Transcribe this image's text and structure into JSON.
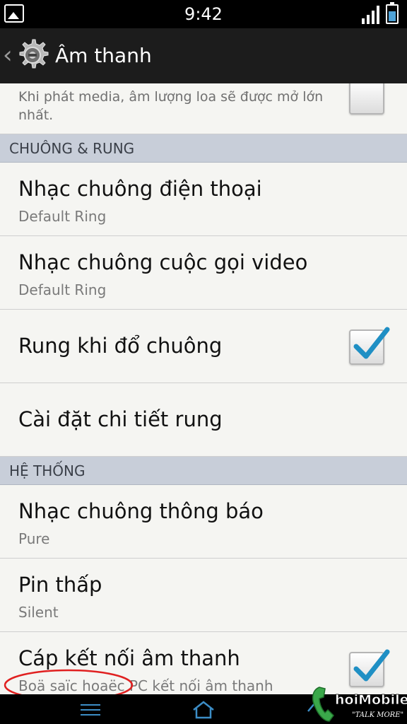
{
  "status_bar": {
    "time": "9:42"
  },
  "action_bar": {
    "title": "Âm thanh"
  },
  "partial_item": {
    "summary": "Khi phát media, âm lượng loa sẽ được mở lớn nhất.",
    "checked": false
  },
  "sections": [
    {
      "header": "CHUÔNG & RUNG",
      "items": [
        {
          "title": "Nhạc chuông điện thoại",
          "subtitle": "Default Ring"
        },
        {
          "title": "Nhạc chuông cuộc gọi video",
          "subtitle": "Default Ring"
        },
        {
          "title": "Rung khi đổ chuông",
          "checked": true
        },
        {
          "title": "Cài đặt chi tiết rung"
        }
      ]
    },
    {
      "header": "HỆ THỐNG",
      "items": [
        {
          "title": "Nhạc chuông thông báo",
          "subtitle": "Pure"
        },
        {
          "title": "Pin thấp",
          "subtitle": "Silent"
        },
        {
          "title": "Cáp kết nối âm thanh",
          "subtitle": "Boä saïc hoaëc PC kết nối âm thanh",
          "checked": true
        }
      ]
    }
  ],
  "watermark": {
    "brand": "hoiMobile",
    "tagline": "\"TALK MORE\""
  },
  "colors": {
    "accent_check": "#1f8fc4",
    "section_header_bg": "#c8ced9",
    "annotation": "#e02020"
  }
}
